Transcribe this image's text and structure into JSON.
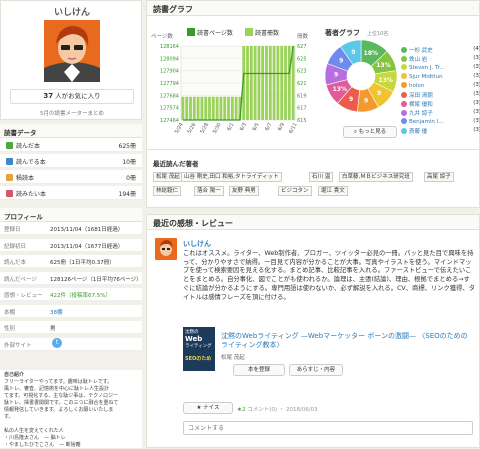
{
  "profile": {
    "name": "いしけん",
    "fav_count": "37",
    "fav_suffix": "人がお気に入り",
    "intro_link": "5月の読書メーターまとめ"
  },
  "book_data": {
    "title": "読書データ",
    "rows": [
      {
        "label": "読んだ本",
        "count": "625冊",
        "color": "#4fa83d"
      },
      {
        "label": "読んでる本",
        "count": "10冊",
        "color": "#3c88c8"
      },
      {
        "label": "積読本",
        "count": "0冊",
        "color": "#e8a23a"
      },
      {
        "label": "読みたい本",
        "count": "194冊",
        "color": "#d8566a"
      }
    ]
  },
  "profile_data": {
    "title": "プロフィール",
    "rows": [
      {
        "k": "登録日",
        "v": "2013/11/04（1681日経過）",
        "cls": ""
      },
      {
        "k": "記録初日",
        "v": "2013/11/04（1677日経過）",
        "cls": ""
      },
      {
        "k": "読んだ本",
        "v": "625冊（1日平均0.37冊）",
        "cls": ""
      },
      {
        "k": "読んだページ",
        "v": "128126ページ（1日平均76ページ）",
        "cls": ""
      },
      {
        "k": "感想・レビュー",
        "v": "422件（投稿率67.5%）",
        "cls": "green"
      },
      {
        "k": "本棚",
        "v": "38棚",
        "cls": "link"
      },
      {
        "k": "性別",
        "v": "男",
        "cls": ""
      },
      {
        "k": "外部サイト",
        "v": "",
        "cls": ""
      }
    ],
    "intro_heading": "自己紹介",
    "intro_lines": [
      "フリーライターやってます。趣味は駄トレです。",
      "風トレ、審査、記憶術を中心に駄トレ人生設計",
      "てます。可視化する、主な駄ジ事は、テクノロジー",
      "駄トレ、揮書書関関です。この三つに融合を重ねて",
      "情報発信していきます。よろしくお願いいたしま",
      "す。",
      "",
      "私の人生を変えてくれた人",
      "・川島隆太さん　— 脳トレ",
      "・やましたひでこさん　— 断捨離"
    ]
  },
  "graph": {
    "title": "読書グラフ",
    "page_label": "ページ数",
    "count_label": "冊数",
    "legend_pages": "読書ページ数",
    "legend_books": "読書冊数",
    "author_title": "著者グラフ",
    "author_sub": "上位10名",
    "more_button": "もっと見る"
  },
  "chart_data": [
    {
      "type": "bar",
      "ylabel": "ページ数",
      "y2label": "冊数",
      "categories": [
        "5/24",
        "5/26",
        "5/28",
        "5/30",
        "6/1",
        "6/3",
        "6/5",
        "6/7",
        "6/9",
        "6/11"
      ],
      "y_ticks": [
        "128164",
        "128094",
        "127904",
        "127794",
        "127684",
        "127574",
        "127464"
      ],
      "y2_ticks": [
        "627",
        "625",
        "623",
        "621",
        "619",
        "617",
        "615"
      ],
      "bars": [
        127684,
        127684,
        127684,
        127684,
        127684,
        127684,
        127684,
        127684,
        127684,
        127684,
        127684,
        127684,
        127684,
        127684,
        127684,
        127684,
        128164,
        128164,
        128164,
        128164,
        128164,
        128164,
        128164,
        128164,
        128164,
        128164,
        128164,
        128164,
        128164,
        128164
      ],
      "line": [
        127464,
        127464,
        127464,
        127464,
        127464,
        127464,
        127464,
        127464,
        127464,
        127464,
        127464,
        127464,
        127464,
        127464,
        127464,
        127464,
        127904,
        127904,
        127904,
        127904,
        127904,
        127904,
        127904,
        127904,
        127904,
        127904,
        127904,
        127904,
        127904,
        128164
      ],
      "ylim": [
        127464,
        128164
      ],
      "colors": {
        "bars": "#9bd35a",
        "line": "#3a9b2d"
      }
    },
    {
      "type": "pie",
      "title": "著者グラフ",
      "labels": [
        "一杉 武史",
        "鉄山 岩",
        "Steven J. Tr...",
        "Sjur Midttun",
        "holon",
        "深田 清朝",
        "横尾 優和",
        "九井 諒子",
        "Benjamin I...",
        "斎藤 優"
      ],
      "values": [
        4,
        3,
        3,
        3,
        3,
        3,
        3,
        3,
        3,
        3
      ],
      "counts": [
        "(4)",
        "(3)",
        "(3)",
        "(3)",
        "(3)",
        "(3)",
        "(3)",
        "(3)",
        "(3)",
        "(3)"
      ],
      "slice_labels": [
        "18%",
        "13%",
        "13%",
        "9",
        "9",
        "9",
        "13%",
        "9",
        "9",
        "9"
      ],
      "colors": [
        "#5cb85c",
        "#86c440",
        "#c6d83b",
        "#f2c230",
        "#f39a2f",
        "#ef5a4e",
        "#e25a9c",
        "#b56fe0",
        "#6e8cf0",
        "#5cc8e8"
      ]
    }
  ],
  "readers": {
    "title": "最近読んだ著者",
    "tags": [
      "松尾 茂起",
      "山谷 剛史,田口 和裕,タトライディット",
      "石川 温",
      "白草藤,ＭＢビジネス研究班",
      "高尾 諒子",
      "林総毅仁",
      "落合 陽一",
      "友野 典男",
      "ビジコタン",
      "堀江 貴文"
    ]
  },
  "review": {
    "title": "最近の感想・レビュー",
    "author": "いしけん",
    "text": "これはオススメ。ライター、Web制作者、ブロガー、ツイッター必見の一冊。パッと見た目で興味を持って、分かりやすさで納得。一目見て内容が分かることが大事。写真やイラストを使う。マインドマップを使って検索要因を見える化する。まとめ記事、比較記事を入れる。ファーストビューで伝えたいことをまとめる。自分事化、図でことがも使われるか。論理は、主張(結論)、理由、根拠でまとめる→すぐに結論が分かるようにする。専門用語は使わないか、必ず解説を入れる。CV、商標、リンク獲得、タイトルは感情フレーズを頂に付ける。",
    "book_title": "沈黙のWebライティング —Webマーケッター ボーンの激闘— 〈SEOのためのライティング教本〉",
    "book_author": "松尾 茂起",
    "cover_line1": "沈黙の",
    "cover_line2": "Web",
    "cover_line3": "ライティング",
    "cover_seo": "SEOのため",
    "btn_register": "本を登録",
    "btn_synopsis": "あらすじ・内容",
    "nice_label": "★ ナイス",
    "nice_count": "2",
    "comment_meta": "コメント(0) ・ 2018/06/03",
    "comment_placeholder": "コメントする"
  }
}
